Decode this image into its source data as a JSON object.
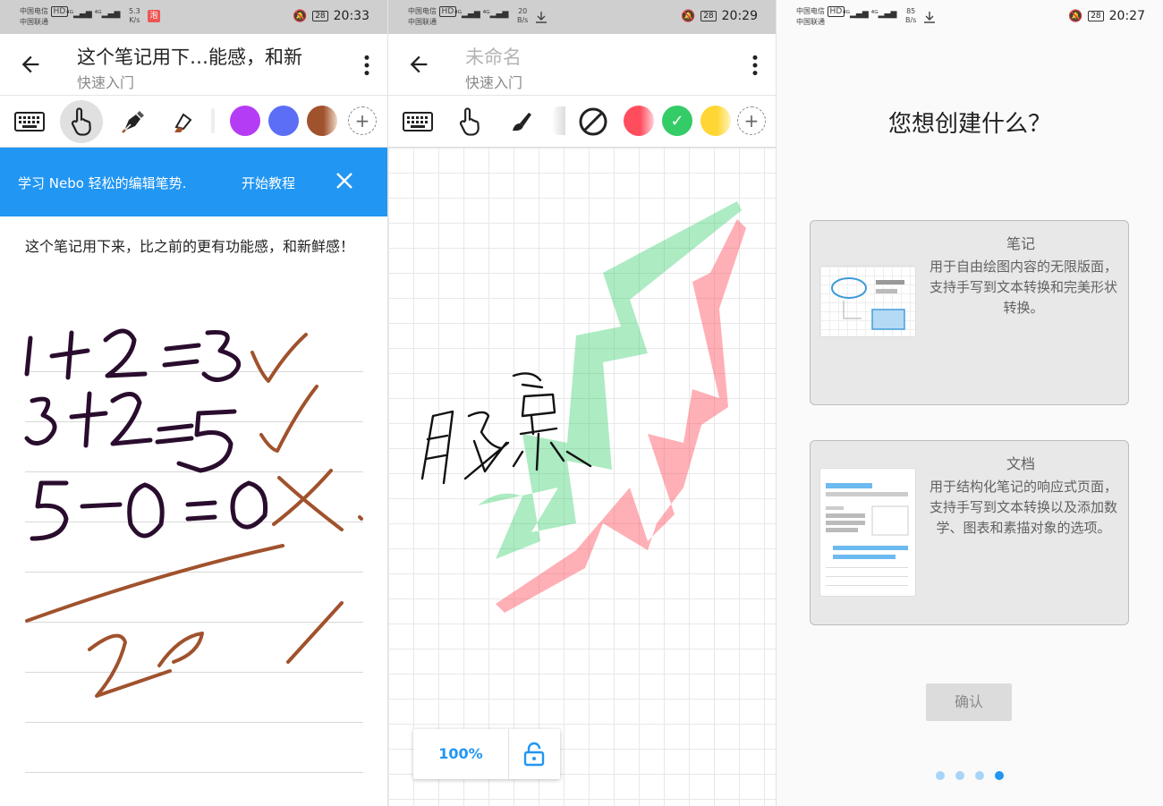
{
  "status_bars": [
    {
      "carrier1": "中国电信",
      "carrier2": "中国联通",
      "hd": "HD",
      "speed": "5.3",
      "speed_unit": "K/s",
      "battery": "28",
      "time": "20:33",
      "app_badge": "泡"
    },
    {
      "carrier1": "中国电信",
      "carrier2": "中国联通",
      "hd": "HD",
      "speed": "20",
      "speed_unit": "B/s",
      "battery": "28",
      "time": "20:29"
    },
    {
      "carrier1": "中国电信",
      "carrier2": "中国联通",
      "hd": "HD",
      "speed": "85",
      "speed_unit": "B/s",
      "battery": "28",
      "time": "20:27"
    }
  ],
  "note_screen": {
    "title": "这个笔记用下…能感，和新",
    "subtitle": "快速入门",
    "swatches": [
      "#b53cf5",
      "#5c6ef5",
      "#a0522d"
    ],
    "banner": {
      "text": "学习 Nebo 轻松的编辑笔势.",
      "action": "开始教程"
    },
    "body_text": "这个笔记用下来，比之前的更有功能感，和新鲜感！",
    "ink_color": "#2a0d2e",
    "correct_color": "#a0522d"
  },
  "draw_screen": {
    "title": "未命名",
    "subtitle": "快速入门",
    "swatches": [
      "#ff4d5e",
      "#33cc66",
      "#ffd633"
    ],
    "zoom": "100%"
  },
  "create_screen": {
    "question": "您想创建什么？",
    "cards": [
      {
        "name": "笔记",
        "description": "用于自由绘图内容的无限版面，支持手写到文本转换和完美形状转换。"
      },
      {
        "name": "文档",
        "description": "用于结构化笔记的响应式页面，支持手写到文本转换以及添加数学、图表和素描对象的选项。"
      }
    ],
    "confirm": "确认",
    "page_dots": 4,
    "active_dot": 3
  },
  "accent_color": "#2196f3"
}
